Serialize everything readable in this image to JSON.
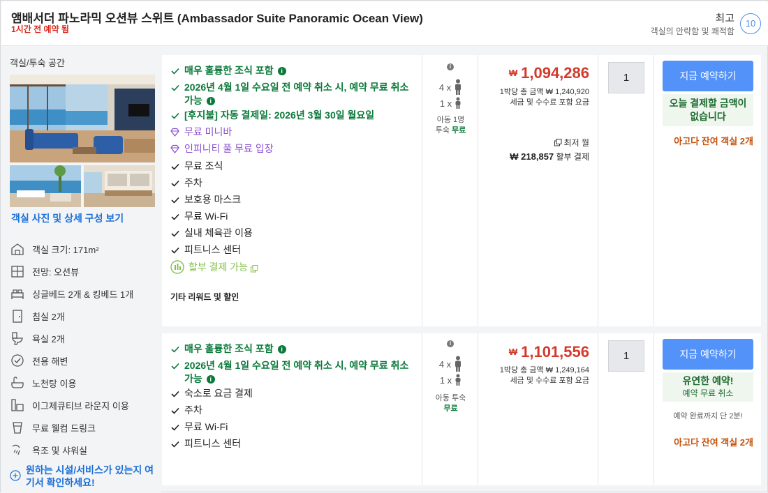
{
  "header": {
    "title": "앰배서더 파노라믹 오션뷰 스위트 (Ambassador Suite Panoramic Ocean View)",
    "booked": "1시간 전 예약 됨",
    "rating_word": "최고",
    "rating_desc": "객실의 안락함 및 쾌적함",
    "score": "10"
  },
  "room": {
    "label": "객실/투숙 공간",
    "photos_link": "객실 사진 및 상세 구성 보기",
    "amenities": [
      {
        "icon": "room-size-icon",
        "label": "객실 크기: 171m²"
      },
      {
        "icon": "view-icon",
        "label": "전망: 오션뷰"
      },
      {
        "icon": "bed-icon",
        "label": "싱글베드 2개 & 킹베드 1개"
      },
      {
        "icon": "door-icon",
        "label": "침실 2개"
      },
      {
        "icon": "toilet-icon",
        "label": "욕실 2개"
      },
      {
        "icon": "check-circle-icon",
        "label": "전용 해변"
      },
      {
        "icon": "bathtub-icon",
        "label": "노천탕 이용"
      },
      {
        "icon": "lounge-icon",
        "label": "이그제큐티브 라운지 이용"
      },
      {
        "icon": "drink-icon",
        "label": "무료 웰컴 드링크"
      },
      {
        "icon": "shower-icon",
        "label": "욕조 및 샤워실"
      }
    ],
    "more_link": "원하는 시설/서비스가 있는지 여기서 확인하세요!"
  },
  "offers": [
    {
      "features": [
        {
          "style": "green",
          "text": "매우 훌륭한 조식 포함",
          "info": true
        },
        {
          "style": "green",
          "text": "2026년 4월 1일 수요일 전 예약 취소 시, 예약 무료 취소 가능",
          "info": true
        },
        {
          "style": "green",
          "text": "[후지불] 자동 결제일: 2026년 3월 30일 월요일",
          "info": false
        },
        {
          "style": "purple",
          "text": "무료 미니바"
        },
        {
          "style": "purple",
          "text": "인피니티 풀 무료 입장"
        },
        {
          "style": "plain",
          "text": "무료 조식"
        },
        {
          "style": "plain",
          "text": "주차"
        },
        {
          "style": "plain",
          "text": "보호용 마스크"
        },
        {
          "style": "plain",
          "text": "무료 Wi-Fi"
        },
        {
          "style": "plain",
          "text": "실내 체육관 이용"
        },
        {
          "style": "plain",
          "text": "피트니스 센터"
        },
        {
          "style": "lime",
          "text": "할부 결제 가능"
        }
      ],
      "other_label": "기타 리워드 및 할인",
      "adults": "4 x",
      "children": "1 x",
      "child_note": "아동 1명",
      "stay_label": "투숙",
      "free_label": "무료",
      "currency": "₩",
      "price": "1,094,286",
      "per_night_label": "1박당 총 금액",
      "total": "₩ 1,240,920",
      "tax_note": "세금 및 수수료 포함 요금",
      "installment_label": "최저 월",
      "installment_amount": "₩ 218,857",
      "installment_suffix": "할부 결제",
      "qty": "1",
      "book_label": "지금 예약하기",
      "pay_note": "오늘 결제할 금액이 없습니다",
      "rooms_left": "아고다 잔여 객실 2개"
    },
    {
      "features": [
        {
          "style": "green",
          "text": "매우 훌륭한 조식 포함",
          "info": true
        },
        {
          "style": "green",
          "text": "2026년 4월 1일 수요일 전 예약 취소 시, 예약 무료 취소 가능",
          "info": true
        },
        {
          "style": "plain",
          "text": "숙소로 요금 결제"
        },
        {
          "style": "plain",
          "text": "주차"
        },
        {
          "style": "plain",
          "text": "무료 Wi-Fi"
        },
        {
          "style": "plain",
          "text": "피트니스 센터"
        }
      ],
      "adults": "4 x",
      "children": "1 x",
      "child_note": "아동 투숙",
      "free_label": "무료",
      "currency": "₩",
      "price": "1,101,556",
      "per_night_label": "1박당 총 금액",
      "total": "₩ 1,249,164",
      "tax_note": "세금 및 수수료 포함 요금",
      "qty": "1",
      "book_label": "지금 예약하기",
      "flex_title": "유연한 예약!",
      "flex_sub": "예약 무료 취소",
      "only_note": "예약 완료까지 단 2분!",
      "rooms_left": "아고다 잔여 객실 2개"
    }
  ],
  "colors": {
    "accent": "#5392f9",
    "price": "#d33a2c",
    "green": "#0b7a3a",
    "purple": "#8a4fd0",
    "orange": "#c4520c",
    "link": "#1a6ed8"
  }
}
